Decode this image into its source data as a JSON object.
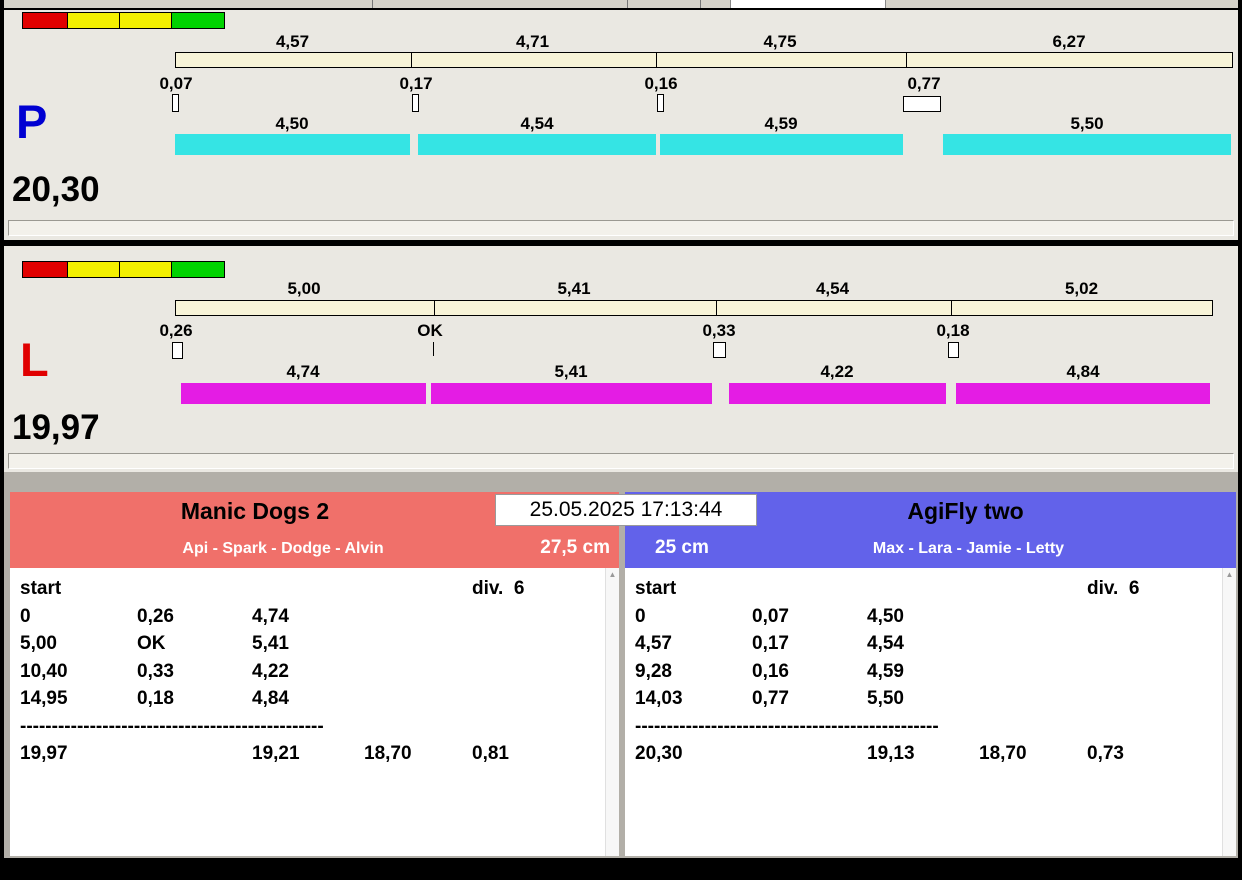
{
  "clock": "25.05.2025 17:13:44",
  "colors": {
    "cyan_bar": "#35e4e4",
    "magenta_bar": "#e41ce4",
    "split_bar": "#f8f4d8",
    "team_left_header": "#f0706a",
    "team_right_header": "#6262ea",
    "lane_p_letter": "#0000d2",
    "lane_l_letter": "#e00000",
    "light_red": "#e10000",
    "light_yellow": "#f3f000",
    "light_green": "#00d300"
  },
  "lane_p": {
    "label": "P",
    "total": "20,30",
    "splits": [
      "4,57",
      "4,71",
      "4,75",
      "6,27"
    ],
    "changes": [
      "0,07",
      "0,17",
      "0,16",
      "0,77"
    ],
    "legs": [
      "4,50",
      "4,54",
      "4,59",
      "5,50"
    ]
  },
  "lane_l": {
    "label": "L",
    "total": "19,97",
    "splits": [
      "5,00",
      "5,41",
      "4,54",
      "5,02"
    ],
    "changes": [
      "0,26",
      "OK",
      "0,33",
      "0,18"
    ],
    "legs": [
      "4,74",
      "5,41",
      "4,22",
      "4,84"
    ]
  },
  "team_left": {
    "name": "Manic Dogs 2",
    "members": "Api - Spark - Dodge - Alvin",
    "jump_height": "27,5 cm",
    "start_label": "start",
    "division": "div.  6",
    "rows": [
      [
        "0",
        "0,26",
        "4,74"
      ],
      [
        "5,00",
        "OK",
        "5,41"
      ],
      [
        "10,40",
        "0,33",
        "4,22"
      ],
      [
        "14,95",
        "0,18",
        "4,84"
      ]
    ],
    "separator": "------------------------------------------------",
    "summary": [
      "19,97",
      "19,21",
      "18,70",
      "0,81"
    ]
  },
  "team_right": {
    "name": "AgiFly two",
    "members": "Max - Lara - Jamie - Letty",
    "jump_height": "25 cm",
    "start_label": "start",
    "division": "div.  6",
    "rows": [
      [
        "0",
        "0,07",
        "4,50"
      ],
      [
        "4,57",
        "0,17",
        "4,54"
      ],
      [
        "9,28",
        "0,16",
        "4,59"
      ],
      [
        "14,03",
        "0,77",
        "5,50"
      ]
    ],
    "separator": "------------------------------------------------",
    "summary": [
      "20,30",
      "19,13",
      "18,70",
      "0,73"
    ]
  }
}
